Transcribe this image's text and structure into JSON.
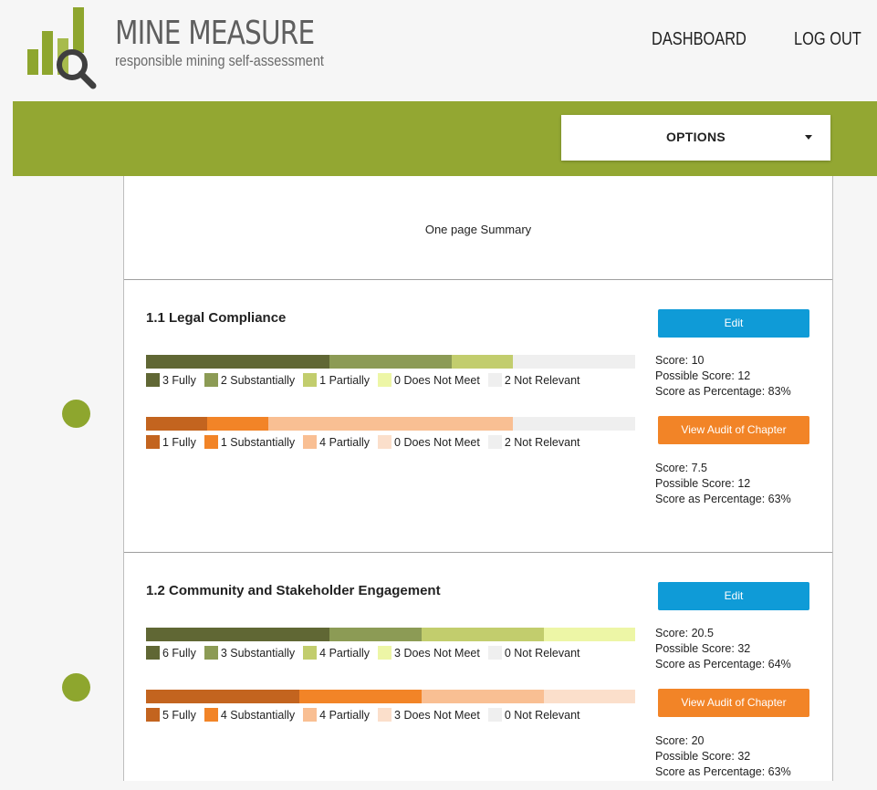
{
  "header": {
    "brand_title": "MINE MEASURE",
    "brand_subtitle": "responsible mining self-assessment",
    "nav": {
      "dashboard": "DASHBOARD",
      "logout": "LOG OUT"
    }
  },
  "options": {
    "label": "OPTIONS",
    "icon": "caret-down-icon"
  },
  "summary": {
    "title": "One page Summary"
  },
  "colors": {
    "green_band": "#93a732",
    "edit_button": "#0f9bd7",
    "audit_button": "#f28427",
    "green_scale": [
      "#606734",
      "#8c9b55",
      "#c2cd6d",
      "#edf6a6",
      "#efefef"
    ],
    "orange_scale": [
      "#c3641f",
      "#f28427",
      "#f9bf93",
      "#fbdfcb",
      "#efefef"
    ]
  },
  "chapters": [
    {
      "title": "1.1 Legal Compliance",
      "edit_label": "Edit",
      "audit_label": "View Audit of Chapter",
      "self": {
        "legend": [
          "3 Fully",
          "2 Substantially",
          "1 Partially",
          "0 Does Not Meet",
          "2 Not Relevant"
        ],
        "counts": [
          3,
          2,
          1,
          0
        ],
        "score": "Score: 10",
        "possible": "Possible Score: 12",
        "percentage": "Score as Percentage: 83%"
      },
      "audit": {
        "legend": [
          "1 Fully",
          "1 Substantially",
          "4 Partially",
          "0 Does Not Meet",
          "2 Not Relevant"
        ],
        "counts": [
          1,
          1,
          4,
          0
        ],
        "score": "Score: 7.5",
        "possible": "Possible Score: 12",
        "percentage": "Score as Percentage: 63%"
      }
    },
    {
      "title": "1.2 Community and Stakeholder Engagement",
      "edit_label": "Edit",
      "audit_label": "View Audit of Chapter",
      "self": {
        "legend": [
          "6 Fully",
          "3 Substantially",
          "4 Partially",
          "3 Does Not Meet",
          "0 Not Relevant"
        ],
        "counts": [
          6,
          3,
          4,
          3
        ],
        "score": "Score: 20.5",
        "possible": "Possible Score: 32",
        "percentage": "Score as Percentage: 64%"
      },
      "audit": {
        "legend": [
          "5 Fully",
          "4 Substantially",
          "4 Partially",
          "3 Does Not Meet",
          "0 Not Relevant"
        ],
        "counts": [
          5,
          4,
          4,
          3
        ],
        "score": "Score: 20",
        "possible": "Possible Score: 32",
        "percentage": "Score as Percentage: 63%"
      }
    }
  ]
}
